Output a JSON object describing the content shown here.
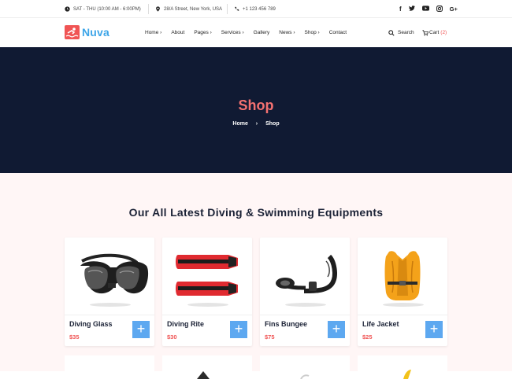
{
  "topbar": {
    "hours": "SAT - THU (10:00 AM - 6:00PM)",
    "address": "28/A Street, New York, USA",
    "phone": "+1 123 456 789",
    "social": [
      "f",
      "t",
      "yt",
      "ig",
      "G+"
    ]
  },
  "nav": {
    "logo": "Nuva",
    "items": [
      "Home",
      "About",
      "Pages",
      "Services",
      "Gallery",
      "News",
      "Shop",
      "Contact"
    ],
    "search": "Search",
    "cart": "Cart",
    "cart_count": "(2)"
  },
  "hero": {
    "title": "Shop",
    "crumb_home": "Home",
    "crumb_current": "Shop"
  },
  "section": {
    "title": "Our All Latest Diving & Swimming Equipments"
  },
  "products": [
    {
      "name": "Diving Glass",
      "price": "$35",
      "image": "diving-mask-icon"
    },
    {
      "name": "Diving Rite",
      "price": "$30",
      "image": "fins-icon"
    },
    {
      "name": "Fins Bungee",
      "price": "$75",
      "image": "snorkel-icon"
    },
    {
      "name": "Life Jacket",
      "price": "$25",
      "image": "life-jacket-icon"
    }
  ],
  "colors": {
    "accent": "#f05454",
    "hero_bg": "#101a33",
    "add_button": "#5da8f0",
    "logo_text": "#3da5e8"
  }
}
